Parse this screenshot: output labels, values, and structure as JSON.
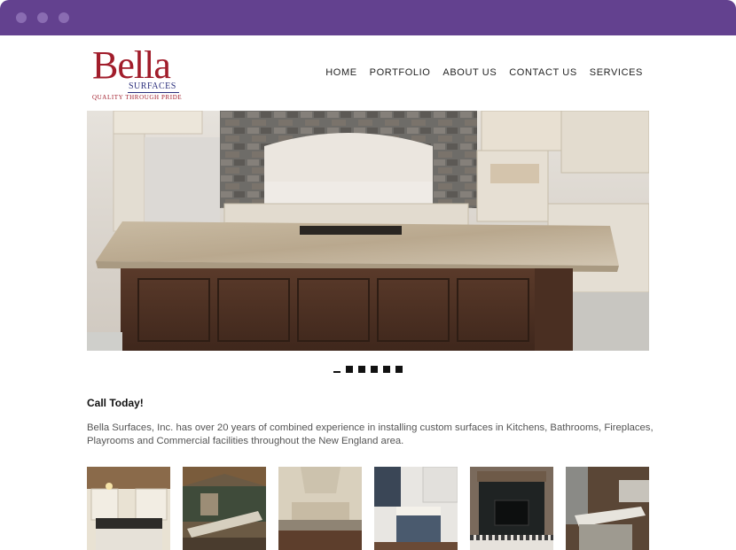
{
  "browser": {
    "dots": [
      "window-dot-1",
      "window-dot-2",
      "window-dot-3"
    ]
  },
  "header": {
    "logo": {
      "word": "Bella",
      "sub": "SURFACES",
      "tagline": "QUALITY THROUGH PRIDE"
    },
    "nav": [
      "HOME",
      "PORTFOLIO",
      "ABOUT US",
      "CONTACT US",
      "SERVICES"
    ]
  },
  "slider": {
    "total": 6,
    "active_index": 0
  },
  "content": {
    "call_title": "Call Today!",
    "about": "Bella Surfaces, Inc. has over 20 years of combined experience in installing custom surfaces in Kitchens, Bathrooms, Fireplaces, Playrooms and Commercial facilities throughout the New England area."
  },
  "colors": {
    "window_bar": "#63418f",
    "logo_red": "#a11d2b",
    "logo_blue": "#2b2f7c"
  }
}
